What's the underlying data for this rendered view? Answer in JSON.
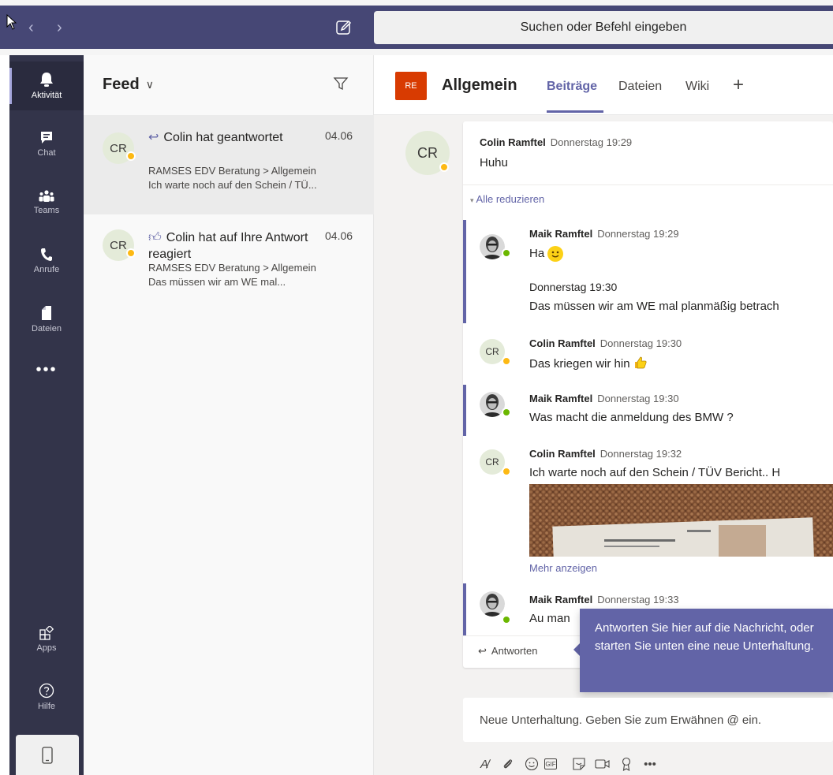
{
  "topbar": {
    "search_placeholder": "Suchen oder Befehl eingeben"
  },
  "rail": {
    "items": [
      {
        "label": "Aktivität",
        "icon": "bell-icon"
      },
      {
        "label": "Chat",
        "icon": "chat-icon"
      },
      {
        "label": "Teams",
        "icon": "teams-icon"
      },
      {
        "label": "Anrufe",
        "icon": "phone-icon"
      },
      {
        "label": "Dateien",
        "icon": "file-icon"
      }
    ],
    "more": "•••",
    "apps_label": "Apps",
    "help_label": "Hilfe"
  },
  "feed": {
    "title": "Feed",
    "items": [
      {
        "avatar": "CR",
        "title": "Colin hat geantwortet",
        "date": "04.06",
        "subtitle": "RAMSES EDV Beratung > Allgemein",
        "preview": "Ich warte noch auf den Schein / TÜ..."
      },
      {
        "avatar": "CR",
        "title": "Colin hat auf Ihre Antwort reagiert",
        "date": "04.06",
        "subtitle": "RAMSES EDV Beratung > Allgemein",
        "preview": "Das müssen wir am WE mal..."
      }
    ]
  },
  "channel": {
    "badge": "RE",
    "name": "Allgemein",
    "tabs": [
      "Beiträge",
      "Dateien",
      "Wiki"
    ],
    "add": "+"
  },
  "thread": {
    "root": {
      "avatar": "CR",
      "author": "Colin Ramftel",
      "time": "Donnerstag 19:29",
      "text": "Huhu"
    },
    "collapse_label": "Alle reduzieren",
    "replies": [
      {
        "author": "Maik Ramftel",
        "time": "Donnerstag 19:29",
        "text": "Ha"
      },
      {
        "author": "",
        "time": "Donnerstag 19:30",
        "text": "Das müssen wir am WE mal planmäßig betrach"
      },
      {
        "author": "Colin Ramftel",
        "time": "Donnerstag 19:30",
        "text": "Das kriegen wir hin",
        "avatar": "CR"
      },
      {
        "author": "Maik Ramftel",
        "time": "Donnerstag 19:30",
        "text": "Was macht die anmeldung des BMW ?"
      },
      {
        "author": "Colin Ramftel",
        "time": "Donnerstag 19:32",
        "text": "Ich warte noch auf den Schein / TÜV Bericht.. H",
        "avatar": "CR"
      },
      {
        "author": "Maik Ramftel",
        "time": "Donnerstag 19:33",
        "text": "Au man"
      }
    ],
    "more_label": "Mehr anzeigen",
    "reply_label": "Antworten"
  },
  "coach": {
    "text": "Antworten Sie hier auf die Nachricht, oder starten Sie unten eine neue Unterhaltung."
  },
  "compose": {
    "placeholder": "Neue Unterhaltung. Geben Sie zum Erwähnen @ ein.",
    "gif": "GIF",
    "more": "•••"
  },
  "colors": {
    "brand": "#464775",
    "accent": "#6264a7",
    "rail": "#33344a",
    "badge": "#d83b01",
    "away": "#fdb913",
    "online": "#6bb700"
  }
}
